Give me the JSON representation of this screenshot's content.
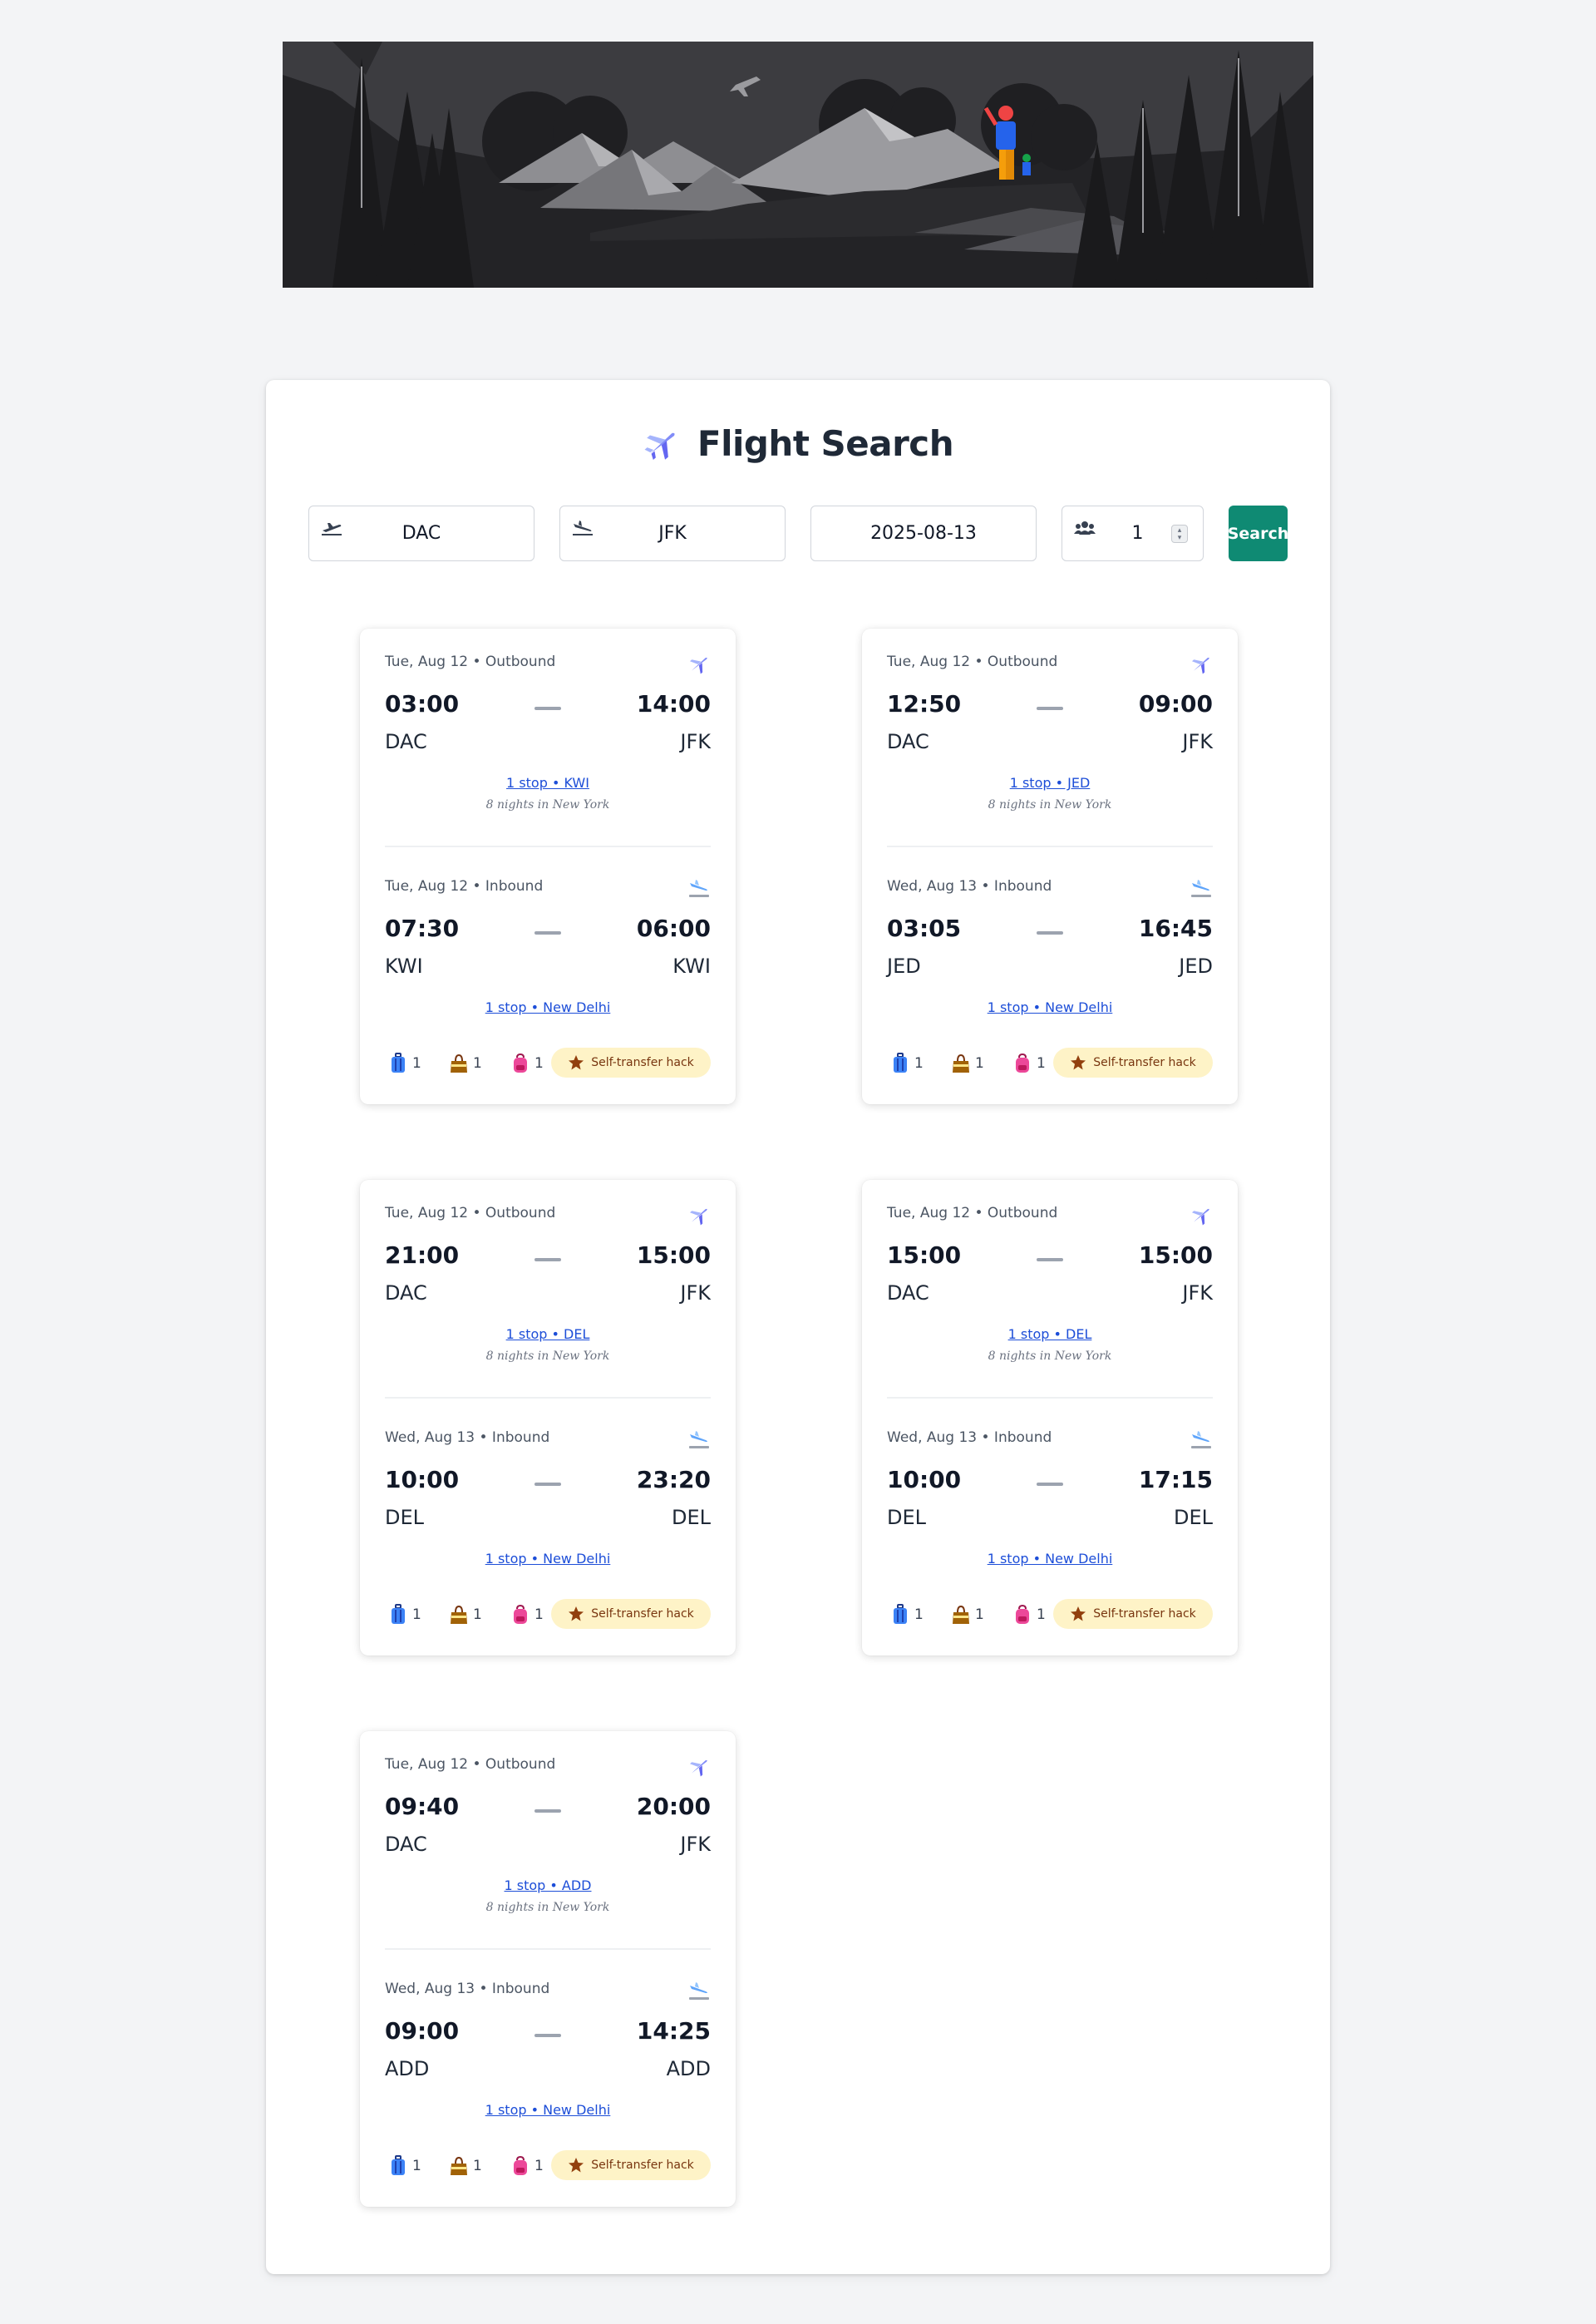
{
  "search": {
    "title": "Flight Search",
    "from": "DAC",
    "to": "JFK",
    "date": "2025-08-13",
    "passengers": "1",
    "button_label": "Search"
  },
  "results": [
    {
      "outbound": {
        "meta": "Tue, Aug 12 • Outbound",
        "dep_time": "03:00",
        "arr_time": "14:00",
        "from": "DAC",
        "to": "JFK",
        "stops": "1 stop • KWI",
        "note": "8 nights in New York"
      },
      "inbound": {
        "meta": "Tue, Aug 12 • Inbound",
        "dep_time": "07:30",
        "arr_time": "06:00",
        "from": "KWI",
        "to": "KWI",
        "stops": "1 stop • New Delhi"
      },
      "bags": {
        "checked": "1",
        "cabin": "1",
        "personal": "1"
      },
      "badge": "Self-transfer hack"
    },
    {
      "outbound": {
        "meta": "Tue, Aug 12 • Outbound",
        "dep_time": "12:50",
        "arr_time": "09:00",
        "from": "DAC",
        "to": "JFK",
        "stops": "1 stop • JED",
        "note": "8 nights in New York"
      },
      "inbound": {
        "meta": "Wed, Aug 13 • Inbound",
        "dep_time": "03:05",
        "arr_time": "16:45",
        "from": "JED",
        "to": "JED",
        "stops": "1 stop • New Delhi"
      },
      "bags": {
        "checked": "1",
        "cabin": "1",
        "personal": "1"
      },
      "badge": "Self-transfer hack"
    },
    {
      "outbound": {
        "meta": "Tue, Aug 12 • Outbound",
        "dep_time": "21:00",
        "arr_time": "15:00",
        "from": "DAC",
        "to": "JFK",
        "stops": "1 stop • DEL",
        "note": "8 nights in New York"
      },
      "inbound": {
        "meta": "Wed, Aug 13 • Inbound",
        "dep_time": "10:00",
        "arr_time": "23:20",
        "from": "DEL",
        "to": "DEL",
        "stops": "1 stop • New Delhi"
      },
      "bags": {
        "checked": "1",
        "cabin": "1",
        "personal": "1"
      },
      "badge": "Self-transfer hack"
    },
    {
      "outbound": {
        "meta": "Tue, Aug 12 • Outbound",
        "dep_time": "15:00",
        "arr_time": "15:00",
        "from": "DAC",
        "to": "JFK",
        "stops": "1 stop • DEL",
        "note": "8 nights in New York"
      },
      "inbound": {
        "meta": "Wed, Aug 13 • Inbound",
        "dep_time": "10:00",
        "arr_time": "17:15",
        "from": "DEL",
        "to": "DEL",
        "stops": "1 stop • New Delhi"
      },
      "bags": {
        "checked": "1",
        "cabin": "1",
        "personal": "1"
      },
      "badge": "Self-transfer hack"
    },
    {
      "outbound": {
        "meta": "Tue, Aug 12 • Outbound",
        "dep_time": "09:40",
        "arr_time": "20:00",
        "from": "DAC",
        "to": "JFK",
        "stops": "1 stop • ADD",
        "note": "8 nights in New York"
      },
      "inbound": {
        "meta": "Wed, Aug 13 • Inbound",
        "dep_time": "09:00",
        "arr_time": "14:25",
        "from": "ADD",
        "to": "ADD",
        "stops": "1 stop • New Delhi"
      },
      "bags": {
        "checked": "1",
        "cabin": "1",
        "personal": "1"
      },
      "badge": "Self-transfer hack"
    }
  ],
  "icons": {
    "from_field": "plane-departure-icon",
    "to_field": "plane-arrival-icon",
    "passengers_field": "users-icon",
    "outbound_leg": "airplane-icon",
    "inbound_leg": "airplane-arrival-icon",
    "checked_bag": "luggage-icon",
    "cabin_bag": "handbag-icon",
    "personal_bag": "backpack-icon",
    "badge": "star-icon"
  },
  "colors": {
    "accent": "#0f8a73",
    "link": "#1d4ed8",
    "badge_bg": "#fef3c7",
    "badge_text": "#78350f",
    "hero_bg": "#232326"
  }
}
